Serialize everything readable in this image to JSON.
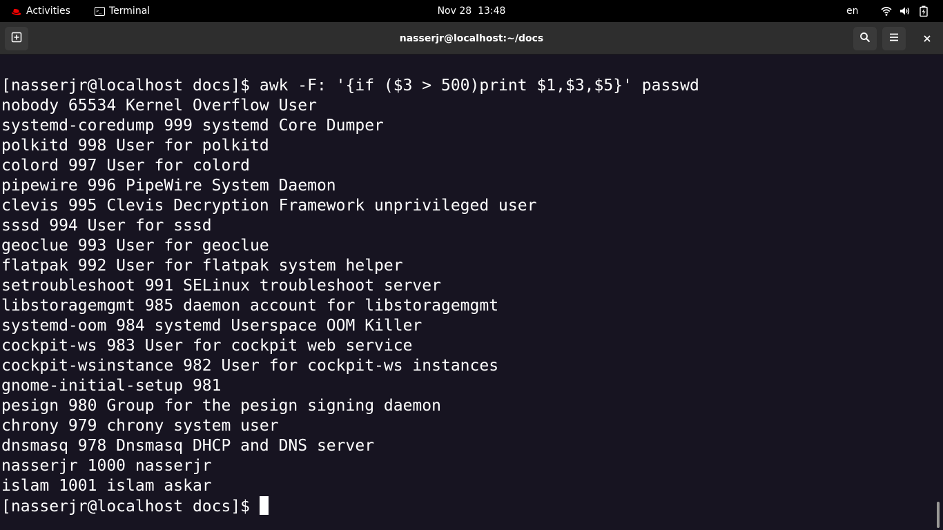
{
  "topbar": {
    "activities_label": "Activities",
    "app_label": "Terminal",
    "clock": "Nov 28  13:48",
    "language": "en",
    "icons": [
      "redhat-icon",
      "terminal-icon",
      "wifi-icon",
      "volume-icon",
      "battery-icon"
    ]
  },
  "window": {
    "title": "nasserjr@localhost:~/docs",
    "icons": [
      "new-tab-icon",
      "search-icon",
      "hamburger-menu-icon",
      "close-icon"
    ]
  },
  "terminal": {
    "lines": [
      "[nasserjr@localhost docs]$ awk -F: '{if ($3 > 500)print $1,$3,$5}' passwd",
      "nobody 65534 Kernel Overflow User",
      "systemd-coredump 999 systemd Core Dumper",
      "polkitd 998 User for polkitd",
      "colord 997 User for colord",
      "pipewire 996 PipeWire System Daemon",
      "clevis 995 Clevis Decryption Framework unprivileged user",
      "sssd 994 User for sssd",
      "geoclue 993 User for geoclue",
      "flatpak 992 User for flatpak system helper",
      "setroubleshoot 991 SELinux troubleshoot server",
      "libstoragemgmt 985 daemon account for libstoragemgmt",
      "systemd-oom 984 systemd Userspace OOM Killer",
      "cockpit-ws 983 User for cockpit web service",
      "cockpit-wsinstance 982 User for cockpit-ws instances",
      "gnome-initial-setup 981",
      "pesign 980 Group for the pesign signing daemon",
      "chrony 979 chrony system user",
      "dnsmasq 978 Dnsmasq DHCP and DNS server",
      "nasserjr 1000 nasserjr",
      "islam 1001 islam askar"
    ],
    "prompt": "[nasserjr@localhost docs]$ ",
    "colors": {
      "background": "#171421",
      "foreground": "#ffffff"
    }
  }
}
